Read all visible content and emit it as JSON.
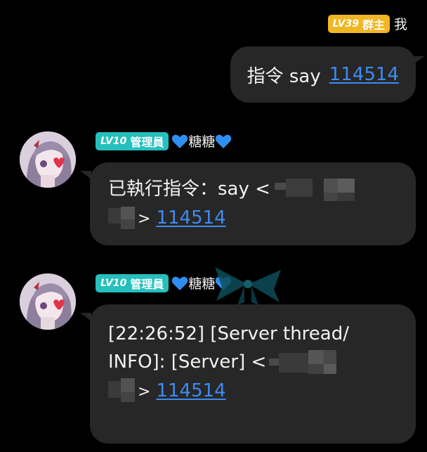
{
  "self_message": {
    "badge_level": "LV39",
    "badge_title": "群主",
    "sender": "我",
    "text_prefix": "指令 say",
    "link": "114514"
  },
  "messages": [
    {
      "badge_level": "LV10",
      "badge_title": "管理員",
      "sender_name": "糖糖",
      "line1": "已執行指令：say <",
      "line2_suffix": ">",
      "link": "114514"
    },
    {
      "badge_level": "LV10",
      "badge_title": "管理員",
      "sender_name": "糖糖",
      "line1": "[22:26:52] [Server thread/",
      "line2": "INFO]: [Server] <",
      "line3_suffix": ">",
      "link": "114514"
    }
  ],
  "colors": {
    "background": "#000000",
    "bubble": "#272727",
    "owner_badge": "#f0b624",
    "admin_badge": "#25c0bd",
    "link": "#3d8bf2",
    "heart": "#2f8ff0"
  },
  "icons": [
    "blue-heart-icon",
    "teal-bow-icon",
    "avatar-image"
  ]
}
